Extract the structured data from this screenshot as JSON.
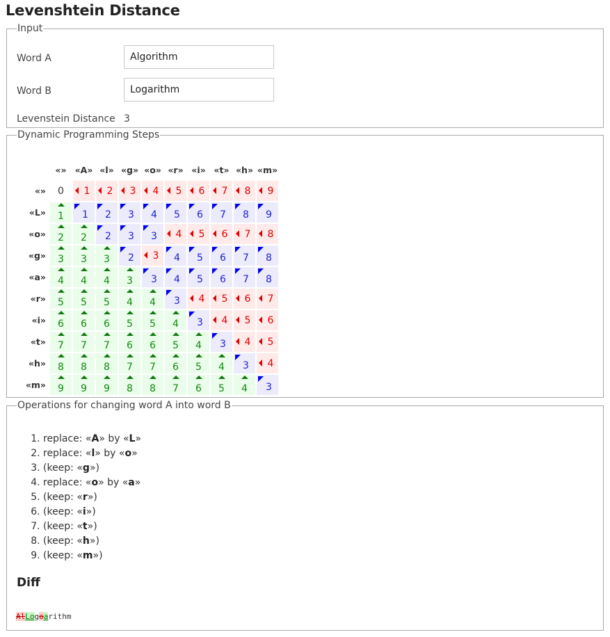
{
  "page": {
    "title": "Levenshtein Distance"
  },
  "input": {
    "legend": "Input",
    "word_a_label": "Word A",
    "word_a_value": "Algorithm",
    "word_b_label": "Word B",
    "word_b_value": "Logarithm",
    "distance_label": "Levenstein Distance",
    "distance_value": "3"
  },
  "steps": {
    "legend": "Dynamic Programming Steps",
    "column_headers": [
      "«»",
      "«A»",
      "«l»",
      "«g»",
      "«o»",
      "«r»",
      "«i»",
      "«t»",
      "«h»",
      "«m»"
    ],
    "rows": [
      {
        "header": "«»",
        "cells": [
          [
            "zero",
            0
          ],
          [
            "left",
            1
          ],
          [
            "left",
            2
          ],
          [
            "left",
            3
          ],
          [
            "left",
            4
          ],
          [
            "left",
            5
          ],
          [
            "left",
            6
          ],
          [
            "left",
            7
          ],
          [
            "left",
            8
          ],
          [
            "left",
            9
          ]
        ]
      },
      {
        "header": "«L»",
        "cells": [
          [
            "up",
            1
          ],
          [
            "diag",
            1
          ],
          [
            "diag",
            2
          ],
          [
            "diag",
            3
          ],
          [
            "diag",
            4
          ],
          [
            "diag",
            5
          ],
          [
            "diag",
            6
          ],
          [
            "diag",
            7
          ],
          [
            "diag",
            8
          ],
          [
            "diag",
            9
          ]
        ]
      },
      {
        "header": "«o»",
        "cells": [
          [
            "up",
            2
          ],
          [
            "up",
            2
          ],
          [
            "diag",
            2
          ],
          [
            "diag",
            3
          ],
          [
            "diag",
            3
          ],
          [
            "left",
            4
          ],
          [
            "left",
            5
          ],
          [
            "left",
            6
          ],
          [
            "left",
            7
          ],
          [
            "left",
            8
          ]
        ]
      },
      {
        "header": "«g»",
        "cells": [
          [
            "up",
            3
          ],
          [
            "up",
            3
          ],
          [
            "up",
            3
          ],
          [
            "diag",
            2
          ],
          [
            "left",
            3
          ],
          [
            "diag",
            4
          ],
          [
            "diag",
            5
          ],
          [
            "diag",
            6
          ],
          [
            "diag",
            7
          ],
          [
            "diag",
            8
          ]
        ]
      },
      {
        "header": "«a»",
        "cells": [
          [
            "up",
            4
          ],
          [
            "up",
            4
          ],
          [
            "up",
            4
          ],
          [
            "up",
            3
          ],
          [
            "diag",
            3
          ],
          [
            "diag",
            4
          ],
          [
            "diag",
            5
          ],
          [
            "diag",
            6
          ],
          [
            "diag",
            7
          ],
          [
            "diag",
            8
          ]
        ]
      },
      {
        "header": "«r»",
        "cells": [
          [
            "up",
            5
          ],
          [
            "up",
            5
          ],
          [
            "up",
            5
          ],
          [
            "up",
            4
          ],
          [
            "up",
            4
          ],
          [
            "diag",
            3
          ],
          [
            "left",
            4
          ],
          [
            "left",
            5
          ],
          [
            "left",
            6
          ],
          [
            "left",
            7
          ]
        ]
      },
      {
        "header": "«i»",
        "cells": [
          [
            "up",
            6
          ],
          [
            "up",
            6
          ],
          [
            "up",
            6
          ],
          [
            "up",
            5
          ],
          [
            "up",
            5
          ],
          [
            "up",
            4
          ],
          [
            "diag",
            3
          ],
          [
            "left",
            4
          ],
          [
            "left",
            5
          ],
          [
            "left",
            6
          ]
        ]
      },
      {
        "header": "«t»",
        "cells": [
          [
            "up",
            7
          ],
          [
            "up",
            7
          ],
          [
            "up",
            7
          ],
          [
            "up",
            6
          ],
          [
            "up",
            6
          ],
          [
            "up",
            5
          ],
          [
            "up",
            4
          ],
          [
            "diag",
            3
          ],
          [
            "left",
            4
          ],
          [
            "left",
            5
          ]
        ]
      },
      {
        "header": "«h»",
        "cells": [
          [
            "up",
            8
          ],
          [
            "up",
            8
          ],
          [
            "up",
            8
          ],
          [
            "up",
            7
          ],
          [
            "up",
            7
          ],
          [
            "up",
            6
          ],
          [
            "up",
            5
          ],
          [
            "up",
            4
          ],
          [
            "diag",
            3
          ],
          [
            "left",
            4
          ]
        ]
      },
      {
        "header": "«m»",
        "cells": [
          [
            "up",
            9
          ],
          [
            "up",
            9
          ],
          [
            "up",
            9
          ],
          [
            "up",
            8
          ],
          [
            "up",
            8
          ],
          [
            "up",
            7
          ],
          [
            "up",
            6
          ],
          [
            "up",
            5
          ],
          [
            "up",
            4
          ],
          [
            "diag",
            3
          ]
        ]
      }
    ]
  },
  "operations": {
    "legend": "Operations for changing word A into word B",
    "items": [
      {
        "type": "replace",
        "from": "A",
        "to": "L"
      },
      {
        "type": "replace",
        "from": "l",
        "to": "o"
      },
      {
        "type": "keep",
        "char": "g"
      },
      {
        "type": "replace",
        "from": "o",
        "to": "a"
      },
      {
        "type": "keep",
        "char": "r"
      },
      {
        "type": "keep",
        "char": "i"
      },
      {
        "type": "keep",
        "char": "t"
      },
      {
        "type": "keep",
        "char": "h"
      },
      {
        "type": "keep",
        "char": "m"
      }
    ],
    "text": {
      "replace_prefix": "replace: «",
      "by": "» by «",
      "suffix": "»",
      "keep_prefix": "(keep: «",
      "keep_suffix": "»)"
    }
  },
  "diff": {
    "heading": "Diff",
    "segments": [
      {
        "kind": "del",
        "text": "Al"
      },
      {
        "kind": "ins",
        "text": "Lo"
      },
      {
        "kind": "same",
        "text": "g"
      },
      {
        "kind": "del",
        "text": "o"
      },
      {
        "kind": "ins",
        "text": "a"
      },
      {
        "kind": "same",
        "text": "rithm"
      }
    ]
  }
}
